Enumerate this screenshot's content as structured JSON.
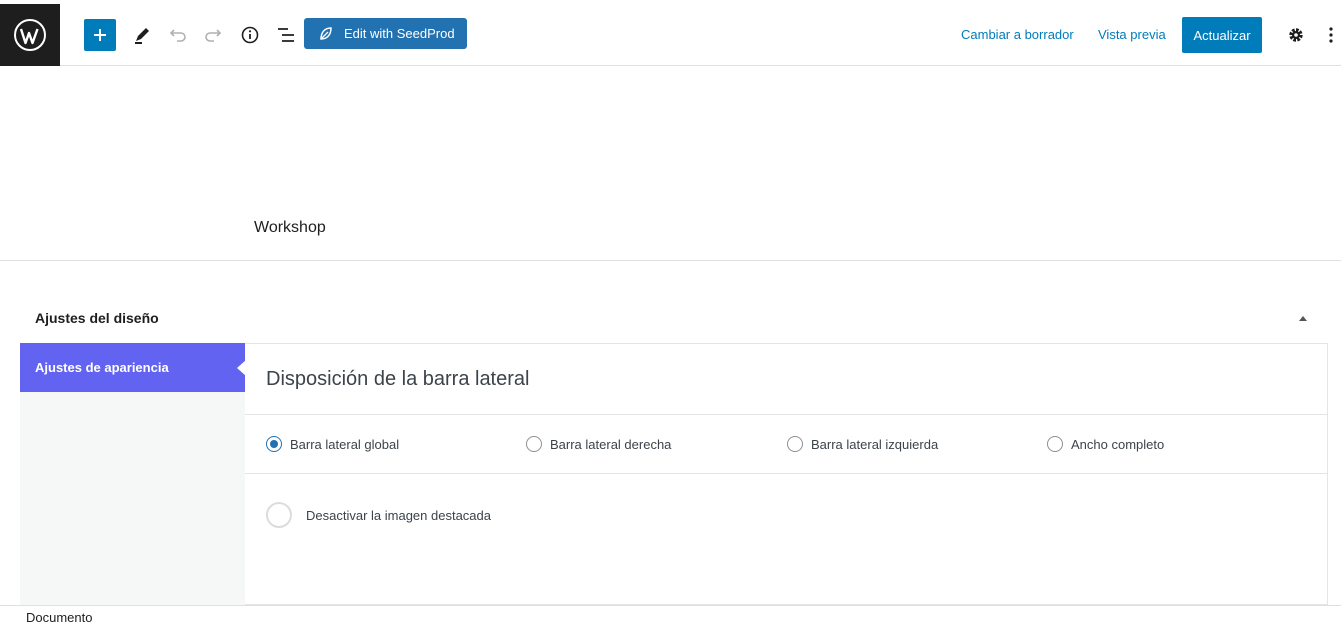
{
  "toolbar": {
    "seedprod_label": "Edit with SeedProd",
    "switch_draft_label": "Cambiar a borrador",
    "preview_label": "Vista previa",
    "update_label": "Actualizar",
    "icons": [
      "wordpress-logo",
      "plus-icon",
      "pencil-icon",
      "undo-icon",
      "redo-icon",
      "info-icon",
      "list-view-icon",
      "seedprod-leaf-icon",
      "gear-icon",
      "more-vertical-icon"
    ]
  },
  "post": {
    "title": "Workshop"
  },
  "metabox": {
    "header": "Ajustes del diseño",
    "tabs": [
      {
        "label": "Ajustes de apariencia",
        "active": true
      }
    ],
    "section_title": "Disposición de la barra lateral",
    "sidebar_options": [
      {
        "label": "Barra lateral global",
        "selected": true
      },
      {
        "label": "Barra lateral derecha",
        "selected": false
      },
      {
        "label": "Barra lateral izquierda",
        "selected": false
      },
      {
        "label": "Ancho completo",
        "selected": false
      }
    ],
    "featured_image_toggle": "Desactivar la imagen destacada"
  },
  "footer": {
    "breadcrumb": "Documento"
  },
  "colors": {
    "accent": "#007cba",
    "tab_active": "#6263f0",
    "seedprod": "#2271b1"
  }
}
